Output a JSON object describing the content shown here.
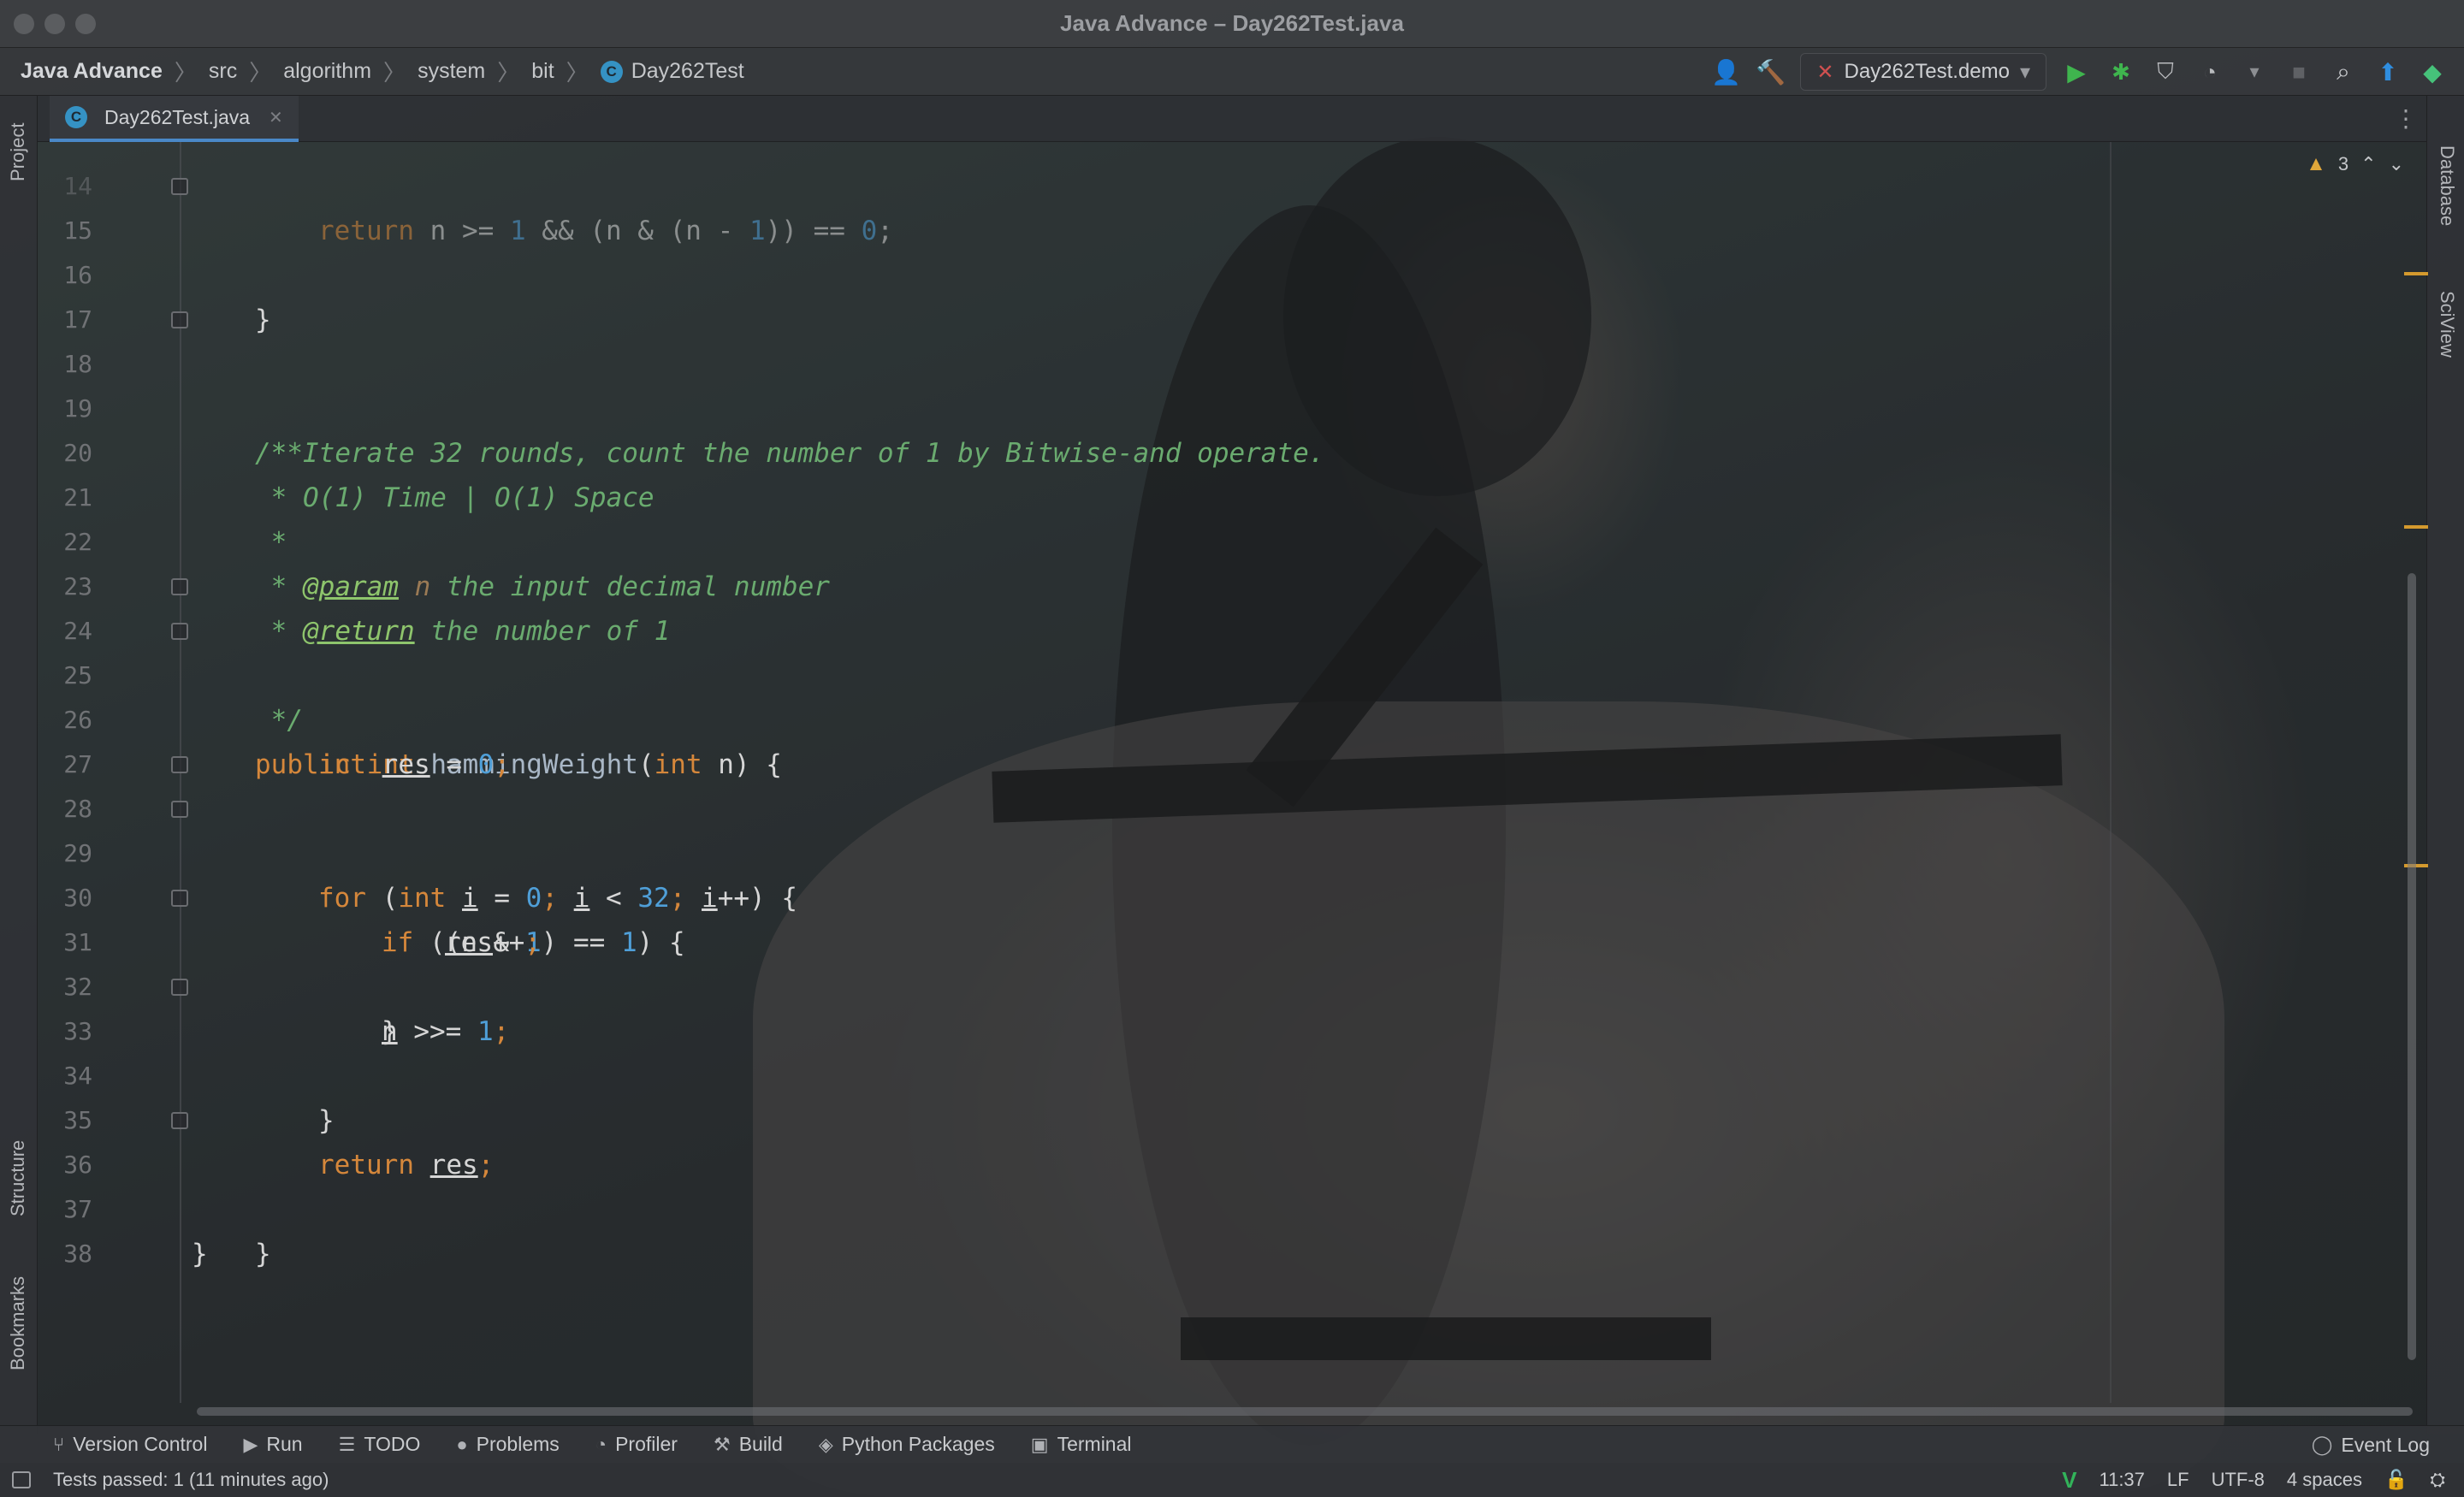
{
  "window": {
    "title": "Java Advance – Day262Test.java"
  },
  "breadcrumbs": [
    "Java Advance",
    "src",
    "algorithm",
    "system",
    "bit",
    "Day262Test"
  ],
  "toolbar": {
    "run_config": "Day262Test.demo"
  },
  "tab": {
    "filename": "Day262Test.java"
  },
  "side_tabs": {
    "left_top": "Project",
    "left_bottom": [
      "Structure",
      "Bookmarks"
    ],
    "right": [
      "Database",
      "SciView"
    ]
  },
  "inspection": {
    "warning_count": "3"
  },
  "editor": {
    "lines": [
      {
        "n": "14",
        "text": "return n >= 1 && (n & (n - 1)) == 0;"
      },
      {
        "n": "15",
        "text": "}"
      },
      {
        "n": "16",
        "text": ""
      },
      {
        "n": "17",
        "text": ""
      },
      {
        "n": "18",
        "text": "/**"
      },
      {
        "n": "19",
        "text": " * Iterate 32 rounds, count the number of 1 by Bitwise-and operate."
      },
      {
        "n": "20",
        "text": " * O(1) Time | O(1) Space"
      },
      {
        "n": "21",
        "text": " *"
      },
      {
        "n": "22",
        "text": " * @param n the input decimal number"
      },
      {
        "n": "23",
        "text": " * @return the number of 1"
      },
      {
        "n": "24",
        "text": " */"
      },
      {
        "n": "25",
        "text": "public int hammingWeight(int n) {"
      },
      {
        "n": "26",
        "text": "int res = 0;"
      },
      {
        "n": "27",
        "text": ""
      },
      {
        "n": "28",
        "text": "for (int i = 0; i < 32; i++) {"
      },
      {
        "n": "29",
        "text": "if ((n & 1) == 1) {"
      },
      {
        "n": "30",
        "text": "res++;"
      },
      {
        "n": "31",
        "text": "}"
      },
      {
        "n": "32",
        "text": "n >>= 1;"
      },
      {
        "n": "33",
        "text": "}"
      },
      {
        "n": "34",
        "text": ""
      },
      {
        "n": "35",
        "text": "return res;"
      },
      {
        "n": "36",
        "text": "}"
      },
      {
        "n": "37",
        "text": "}"
      },
      {
        "n": "38",
        "text": ""
      }
    ]
  },
  "tool_windows": [
    "Version Control",
    "Run",
    "TODO",
    "Problems",
    "Profiler",
    "Build",
    "Python Packages",
    "Terminal"
  ],
  "event_log": "Event Log",
  "status": {
    "message": "Tests passed: 1 (11 minutes ago)",
    "position": "11:37",
    "line_sep": "LF",
    "encoding": "UTF-8",
    "indent": "4 spaces"
  },
  "colors": {
    "keyword": "#d5873b",
    "number": "#4f9fd8",
    "doc_comment": "#6aab6f",
    "accent": "#4a88c7",
    "warning": "#e0a73a"
  }
}
